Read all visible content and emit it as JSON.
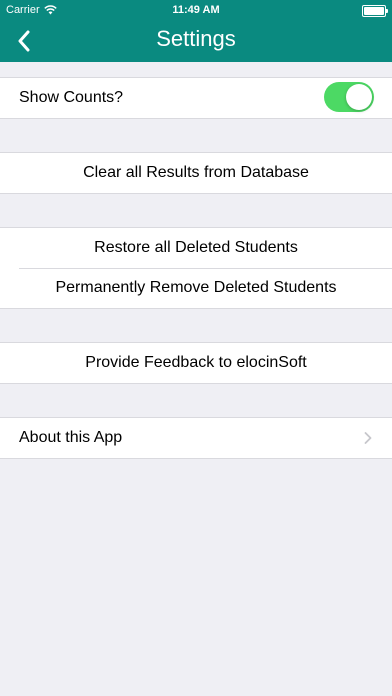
{
  "status_bar": {
    "carrier": "Carrier",
    "time": "11:49 AM"
  },
  "nav": {
    "title": "Settings",
    "back_icon": "chevron-left-icon"
  },
  "sections": {
    "show_counts": {
      "label": "Show Counts?",
      "enabled": true
    },
    "clear_results": {
      "label": "Clear all Results from Database"
    },
    "restore_students": {
      "label": "Restore all Deleted Students"
    },
    "remove_students": {
      "label": "Permanently Remove Deleted Students"
    },
    "feedback": {
      "label": "Provide Feedback to elocinSoft"
    },
    "about": {
      "label": "About this App",
      "icon": "chevron-right-icon"
    }
  },
  "colors": {
    "nav_background": "#0a8a80",
    "toggle_on": "#4cd964",
    "page_background": "#efeff4"
  }
}
